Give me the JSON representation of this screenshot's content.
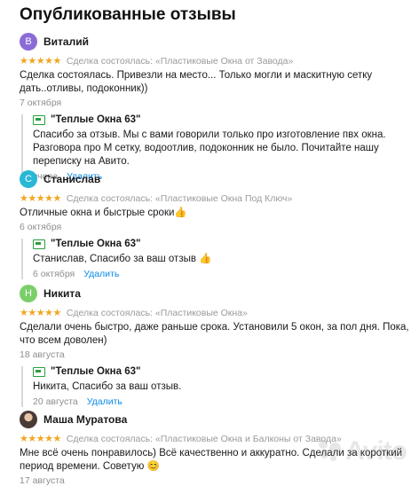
{
  "page_title": "Опубликованные отзывы",
  "stars": "★★★★★",
  "delete_label": "Удалить",
  "colors": {
    "star": "#f2a623",
    "link": "#0a8ae8",
    "shop_icon": "#2a9d3d"
  },
  "reviews": [
    {
      "initial": "В",
      "avatar_color": "#8b6bd6",
      "author": "Виталий",
      "deal": "Сделка состоялась: «Пластиковые Окна от Завода»",
      "text": "Сделка состоялась. Привезли на место... Только могли и маскитную сетку дать..отливы, подоконник))",
      "date": "7 октября",
      "reply": {
        "shop": "\"Теплые Окна 63\"",
        "text": "Спасибо за отзыв. Мы с вами говорили только про изготовление пвх окна. Разговора про М сетку, водоотлив, подоконник не было. Почитайте нашу переписку на Авито.",
        "date": "вчера"
      }
    },
    {
      "initial": "С",
      "avatar_color": "#29b7d6",
      "author": "Станислав",
      "deal": "Сделка состоялась: «Пластиковые Окна Под Ключ»",
      "text": "Отличные окна и быстрые сроки👍",
      "date": "6 октября",
      "reply": {
        "shop": "\"Теплые Окна 63\"",
        "text": "Станислав, Спасибо за ваш отзыв 👍",
        "date": "6 октября"
      }
    },
    {
      "initial": "Н",
      "avatar_color": "#7bcf6a",
      "author": "Никита",
      "deal": "Сделка состоялась: «Пластиковые Окна»",
      "text": "Сделали очень быстро, даже раньше срока. Установили 5 окон, за пол дня. Пока, что всем доволен)",
      "date": "18 августа",
      "reply": {
        "shop": "\"Теплые Окна 63\"",
        "text": "Никита, Спасибо за ваш отзыв.",
        "date": "20 августа"
      }
    },
    {
      "initial": "",
      "avatar_color": "#6b5a55",
      "author": "Маша Муратова",
      "deal": "Сделка состоялась: «Пластиковые Окна и Балконы от Завода»",
      "text": "Мне всё очень понравилось) Всё качественно и аккуратно. Сделали за короткий период времени. Советую 😊",
      "date": "17 августа"
    }
  ],
  "watermark": "Avito"
}
